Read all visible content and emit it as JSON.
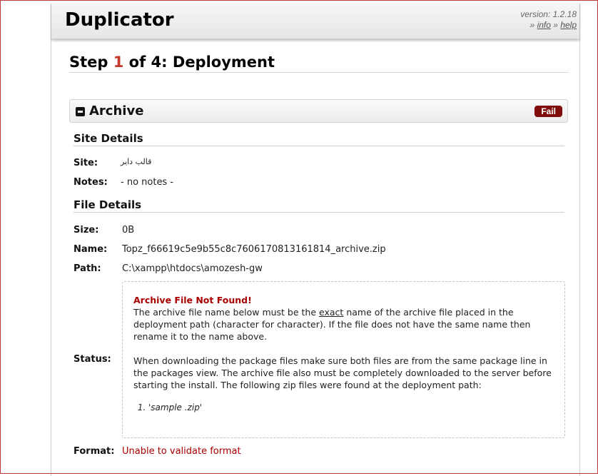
{
  "header": {
    "app_title": "Duplicator",
    "version_text": "version: 1.2.18",
    "sep1": "»",
    "info_link": "info",
    "sep2": "»",
    "help_link": "help"
  },
  "step": {
    "prefix": "Step ",
    "number": "1",
    "suffix": " of 4: Deployment"
  },
  "section": {
    "label": "Archive",
    "status_badge": "Fail"
  },
  "site_details": {
    "heading": "Site Details",
    "site_label": "Site:",
    "site_value": "قالب دایر",
    "notes_label": "Notes:",
    "notes_value": "- no notes -"
  },
  "file_details": {
    "heading": "File Details",
    "size_label": "Size:",
    "size_value": "0B",
    "name_label": "Name:",
    "name_value": "Topz_f66619c5e9b55c8c7606170813161814_archive.zip",
    "path_label": "Path:",
    "path_value": "C:\\xampp\\htdocs\\amozesh-gw",
    "status_label": "Status:",
    "format_label": "Format:",
    "format_value": "Unable to validate format"
  },
  "notice": {
    "title": "Archive File Not Found!",
    "p1_before": "The archive file name below must be the ",
    "p1_emph": "exact",
    "p1_after": " name of the archive file placed in the deployment path (character for character). If the file does not have the same name then rename it to the name above.",
    "p2": "When downloading the package files make sure both files are from the same package line in the packages view. The archive file also must be completely downloaded to the server before starting the install. The following zip files were found at the deployment path:",
    "found_files": [
      "'sample .zip'"
    ]
  },
  "colors": {
    "accent_red": "#c53a2a",
    "fail_badge": "#7f0b0b",
    "error_text": "#a00000"
  }
}
